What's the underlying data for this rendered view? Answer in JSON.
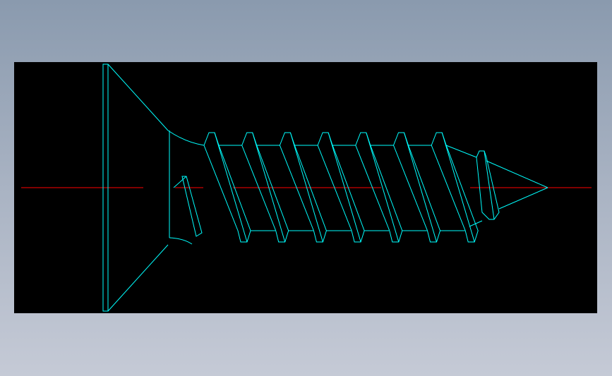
{
  "drawing": {
    "background_color": "#000000",
    "outline_color": "#00ffff",
    "centerline_color": "#ff0000",
    "subject_icon": "countersunk-self-tapping-screw",
    "thread_turns_shown": 8
  }
}
